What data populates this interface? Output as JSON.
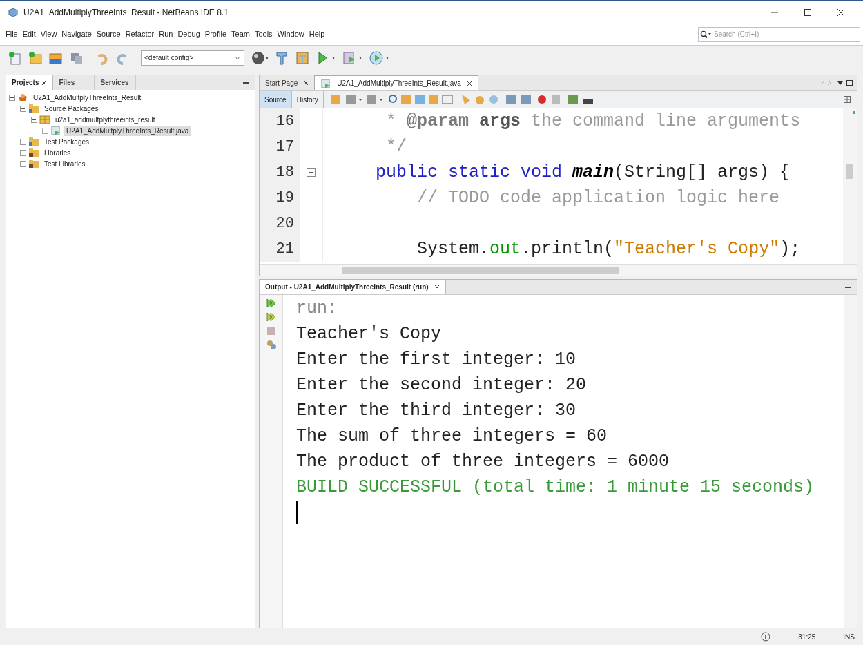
{
  "window": {
    "title": "U2A1_AddMultiplyThreeInts_Result - NetBeans IDE 8.1"
  },
  "menu": [
    "File",
    "Edit",
    "View",
    "Navigate",
    "Source",
    "Refactor",
    "Run",
    "Debug",
    "Profile",
    "Team",
    "Tools",
    "Window",
    "Help"
  ],
  "search": {
    "placeholder": "Search (Ctrl+I)"
  },
  "toolbar": {
    "config": "<default config>"
  },
  "side_tabs": [
    {
      "label": "Projects",
      "selected": true,
      "closable": true
    },
    {
      "label": "Files",
      "selected": false,
      "closable": false
    },
    {
      "label": "Services",
      "selected": false,
      "closable": false
    }
  ],
  "tree": [
    {
      "label": "U2A1_AddMultplyThreeInts_Result",
      "kind": "project",
      "expanded": true,
      "selected": false,
      "children": [
        {
          "label": "Source Packages",
          "kind": "folder",
          "expanded": true,
          "selected": false,
          "children": [
            {
              "label": "u2a1_addmultplythreeints_result",
              "kind": "package",
              "expanded": true,
              "selected": false,
              "children": [
                {
                  "label": "U2A1_AddMultplyThreeInts_Result.java",
                  "kind": "file",
                  "selected": true
                }
              ]
            }
          ]
        },
        {
          "label": "Test Packages",
          "kind": "folder",
          "expanded": false,
          "selected": false
        },
        {
          "label": "Libraries",
          "kind": "library",
          "expanded": false,
          "selected": false
        },
        {
          "label": "Test Libraries",
          "kind": "library",
          "expanded": false,
          "selected": false
        }
      ]
    }
  ],
  "editor_tabs": [
    {
      "label": "Start Page",
      "selected": false
    },
    {
      "label": "U2A1_AddMultiplyThreeInts_Result.java",
      "selected": true
    }
  ],
  "view_toggle": [
    {
      "label": "Source",
      "selected": true
    },
    {
      "label": "History",
      "selected": false
    }
  ],
  "code": [
    {
      "number": "16",
      "fold_toggle": false,
      "tokens": [
        {
          "text": "     * ",
          "kind": "comment"
        },
        {
          "text": "@param",
          "kind": "tag"
        },
        {
          "text": " args",
          "kind": "tagarg"
        },
        {
          "text": " the command line arguments",
          "kind": "comment"
        }
      ]
    },
    {
      "number": "17",
      "fold_toggle": false,
      "tokens": [
        {
          "text": "     */",
          "kind": "comment"
        }
      ]
    },
    {
      "number": "18",
      "fold_toggle": true,
      "tokens": [
        {
          "text": "    public static void ",
          "kind": "keyword"
        },
        {
          "text": "main",
          "kind": "method"
        },
        {
          "text": "(String[] args) {",
          "kind": "plain"
        }
      ]
    },
    {
      "number": "19",
      "fold_toggle": false,
      "tokens": [
        {
          "text": "        // TODO code application logic here",
          "kind": "comment"
        }
      ]
    },
    {
      "number": "20",
      "fold_toggle": false
    },
    {
      "number": "21",
      "fold_toggle": false,
      "tokens": [
        {
          "text": "        System.",
          "kind": "plain"
        },
        {
          "text": "out",
          "kind": "field"
        },
        {
          "text": ".println(",
          "kind": "plain"
        },
        {
          "text": "\"Teacher's Copy\"",
          "kind": "string"
        },
        {
          "text": ");",
          "kind": "plain"
        }
      ]
    }
  ],
  "output": {
    "title": "Output - U2A1_AddMultiplyThreeInts_Result (run)",
    "lines": [
      {
        "text": "run:",
        "kind": "muted"
      },
      {
        "text": "Teacher's Copy",
        "kind": "plain"
      },
      {
        "text": "Enter the first integer: 10",
        "kind": "plain"
      },
      {
        "text": "Enter the second integer: 20",
        "kind": "plain"
      },
      {
        "text": "Enter the third integer: 30",
        "kind": "plain"
      },
      {
        "text": "The sum of three integers = 60",
        "kind": "plain"
      },
      {
        "text": "The product of three integers = 6000",
        "kind": "plain"
      },
      {
        "text": "BUILD SUCCESSFUL (total time: 1 minute 15 seconds)",
        "kind": "success"
      }
    ]
  },
  "status_bar": {
    "position": "31:25",
    "mode": "INS"
  }
}
